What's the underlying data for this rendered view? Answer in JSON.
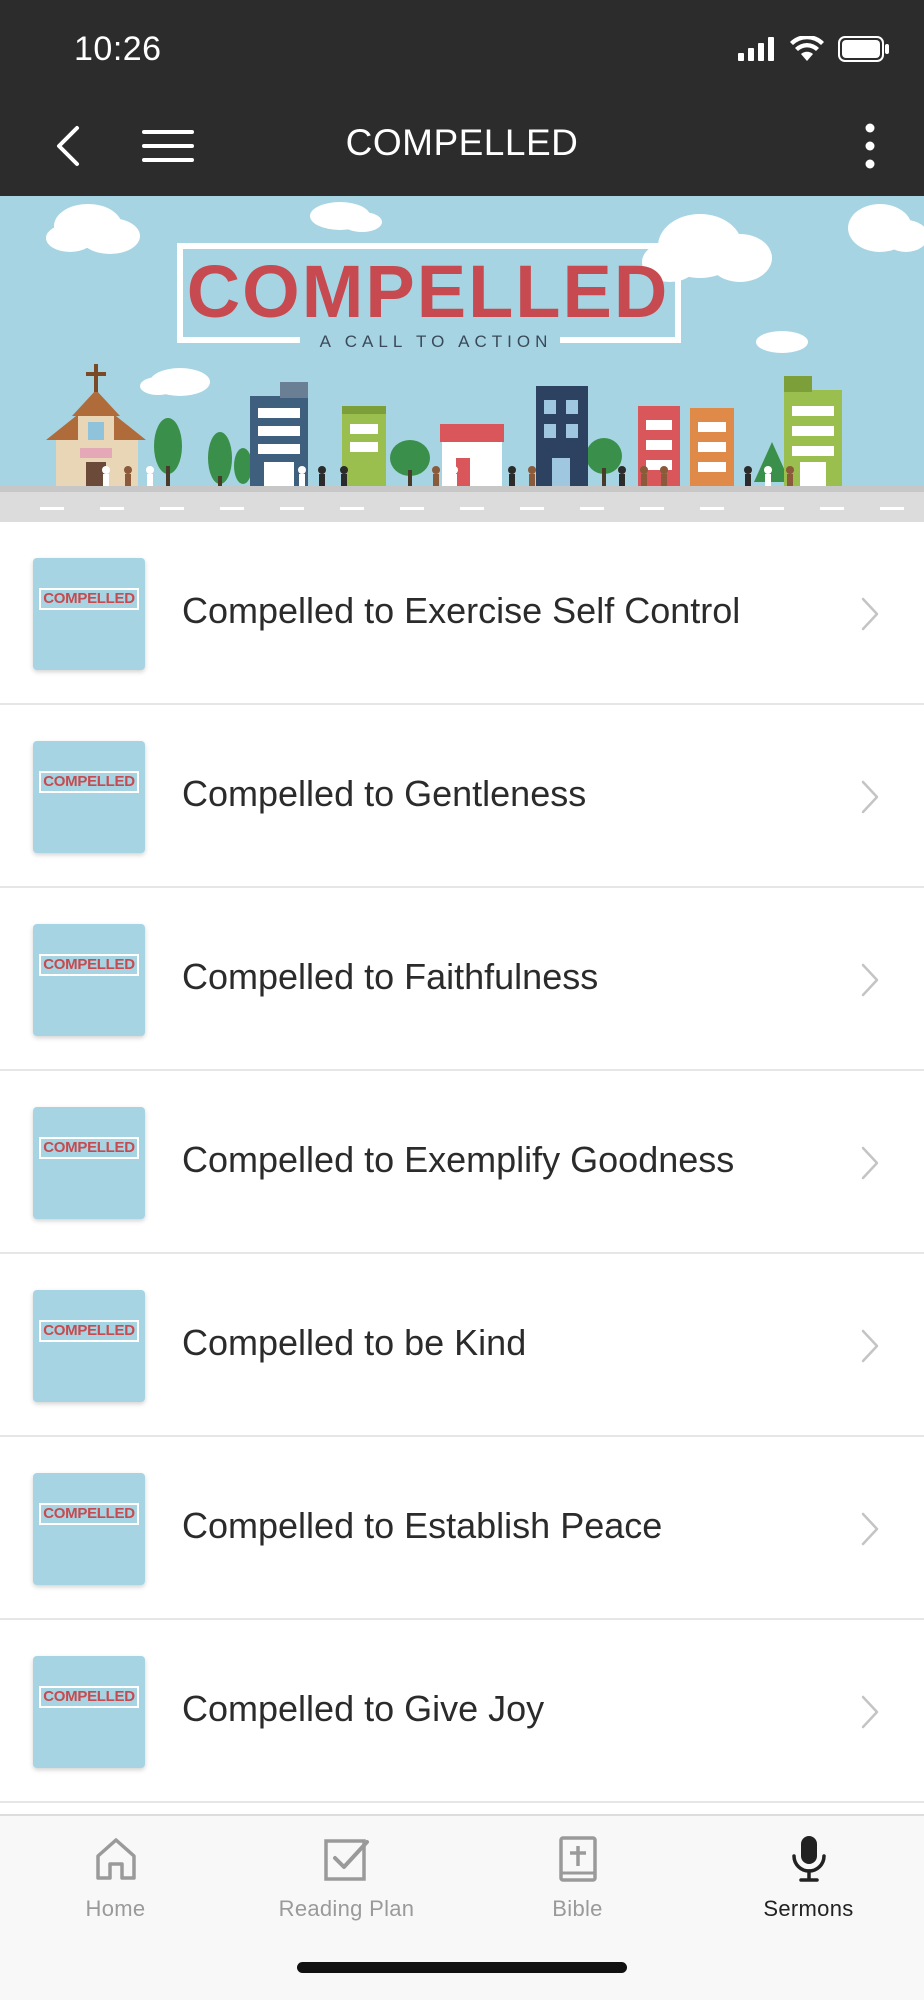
{
  "status_bar": {
    "time": "10:26"
  },
  "header": {
    "title": "COMPELLED"
  },
  "banner": {
    "title": "COMPELLED",
    "subtitle": "A CALL TO ACTION"
  },
  "thumbnail": {
    "title": "COMPELLED"
  },
  "sermons": [
    {
      "title": "Compelled to Exercise Self Control"
    },
    {
      "title": "Compelled to Gentleness"
    },
    {
      "title": "Compelled to Faithfulness"
    },
    {
      "title": "Compelled to Exemplify Goodness"
    },
    {
      "title": "Compelled to be Kind"
    },
    {
      "title": "Compelled to Establish Peace"
    },
    {
      "title": "Compelled to Give Joy"
    }
  ],
  "tabs": [
    {
      "label": "Home",
      "icon": "home-icon",
      "active": false
    },
    {
      "label": "Reading Plan",
      "icon": "checkbox-icon",
      "active": false
    },
    {
      "label": "Bible",
      "icon": "bible-icon",
      "active": false
    },
    {
      "label": "Sermons",
      "icon": "microphone-icon",
      "active": true
    }
  ],
  "colors": {
    "header_bg": "#2c2c2c",
    "banner_sky": "#a6d4e2",
    "banner_title": "#c64a4f",
    "tab_active": "#222222",
    "tab_inactive": "#9a9a9a"
  }
}
